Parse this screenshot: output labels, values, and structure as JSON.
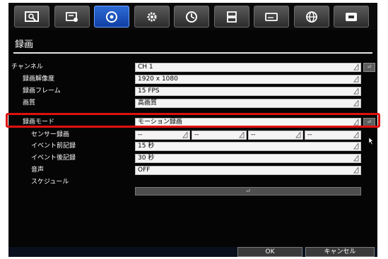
{
  "tabs": [
    {
      "icon": "camera-display-icon",
      "active": false
    },
    {
      "icon": "record-settings-icon",
      "active": false
    },
    {
      "icon": "record-icon",
      "active": true
    },
    {
      "icon": "gear-icon",
      "active": false
    },
    {
      "icon": "clock-icon",
      "active": false
    },
    {
      "icon": "storage-icon",
      "active": false
    },
    {
      "icon": "dvr-device-icon",
      "active": false
    },
    {
      "icon": "network-globe-icon",
      "active": false
    },
    {
      "icon": "system-info-icon",
      "active": false
    }
  ],
  "page_title": "録画",
  "rows": {
    "channel": {
      "label": "チャンネル",
      "value": "CH 1"
    },
    "resolution": {
      "label": "録画解像度",
      "value": "1920 x 1080"
    },
    "frame": {
      "label": "録画フレーム",
      "value": "15 FPS"
    },
    "quality": {
      "label": "画質",
      "value": "高画質"
    },
    "mode": {
      "label": "録画モード",
      "value": "モーション録画"
    },
    "sensor": {
      "label": "センサー録画",
      "values": [
        "--",
        "--",
        "--",
        "--"
      ]
    },
    "pre_event": {
      "label": "イベント前記録",
      "value": "15 秒"
    },
    "post_event": {
      "label": "イベント後記録",
      "value": "30 秒"
    },
    "audio": {
      "label": "音声",
      "value": "OFF"
    },
    "schedule": {
      "label": "スケジュール"
    }
  },
  "buttons": {
    "ok": "OK",
    "cancel": "キャンセル"
  },
  "colors": {
    "accent": "#1f58c8",
    "highlight": "#e01010",
    "background": "#050505"
  }
}
